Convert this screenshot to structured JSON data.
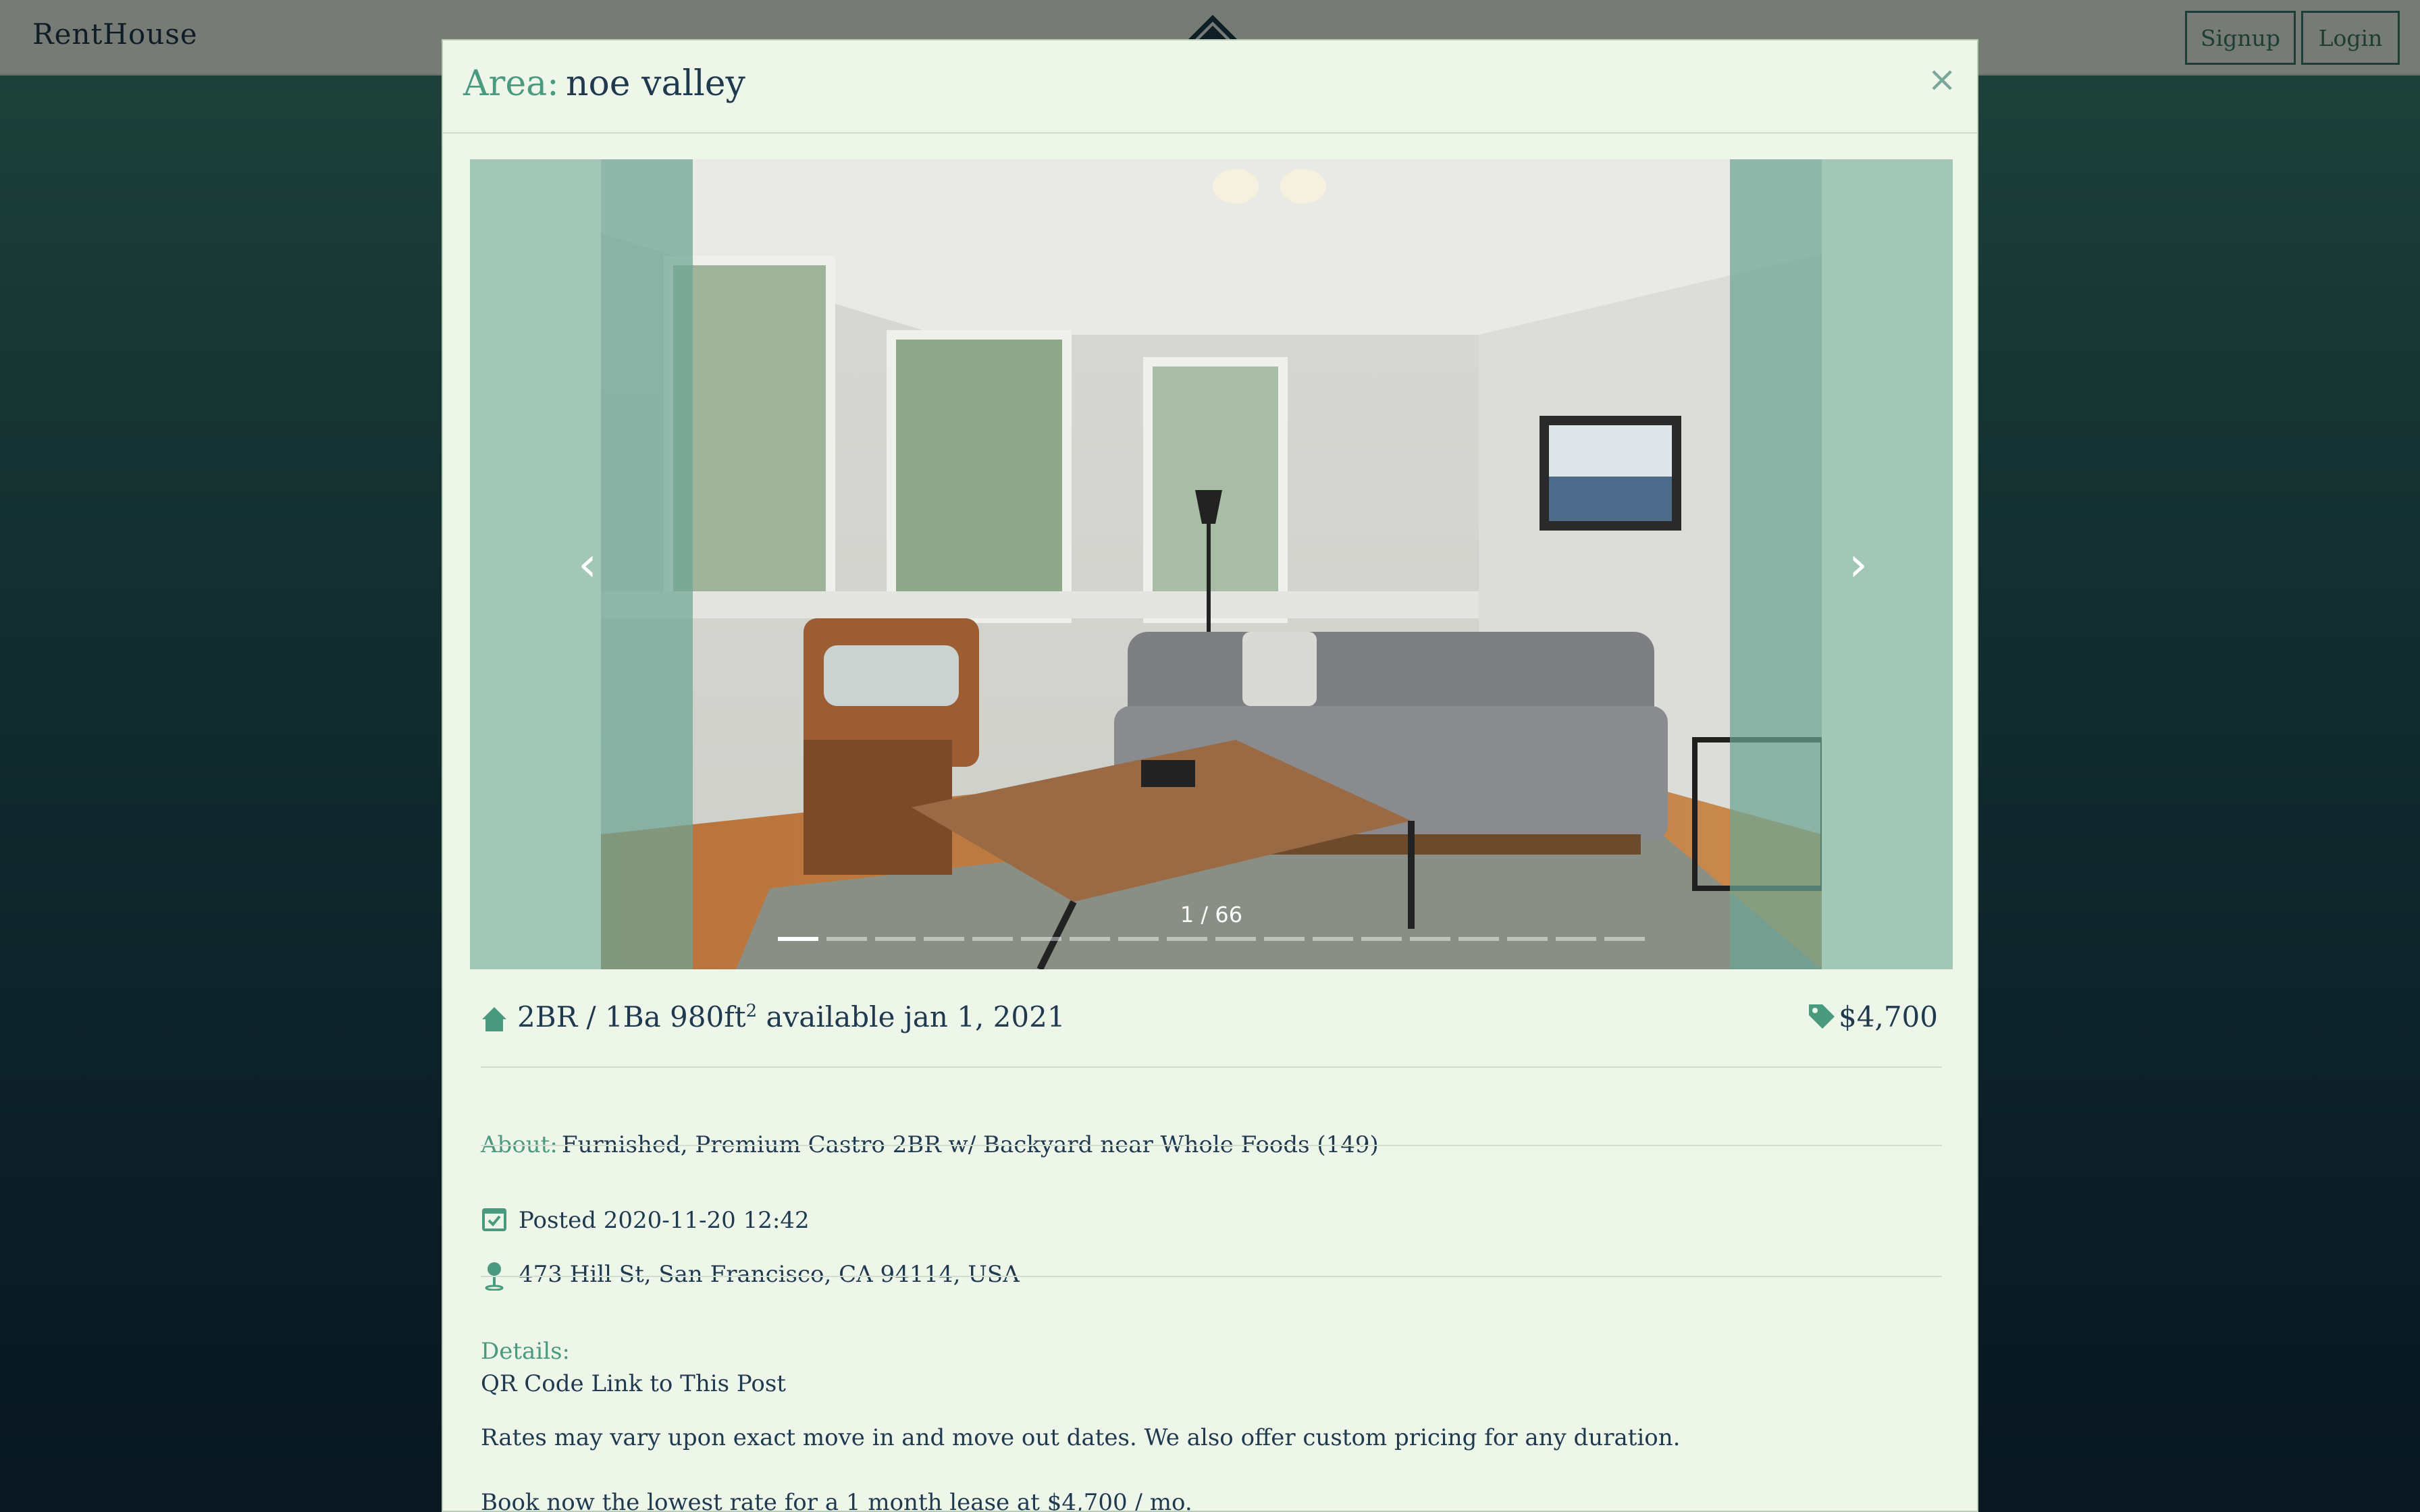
{
  "navbar": {
    "brand": "RentHouse",
    "signup_label": "Signup",
    "login_label": "Login"
  },
  "modal": {
    "area_label": "Area:",
    "area_value": "noe valley",
    "close_label": "×"
  },
  "carousel": {
    "counter": "1 / 66",
    "prev_label": "‹",
    "next_label": "›",
    "dot_count_visible": 18,
    "active_dot": 0
  },
  "listing": {
    "beds_baths": "2BR / 1Ba 980ft",
    "area_sup": "2",
    "available": "available jan 1, 2021",
    "price": "$4,700",
    "about_label": "About:",
    "about_text": "Furnished, Premium Castro 2BR w/ Backyard near Whole Foods (149)",
    "posted": "Posted 2020-11-20 12:42",
    "address": "473 Hill St, San Francisco, CA 94114, USA",
    "details_label": "Details:",
    "qr_link": "QR Code Link to This Post",
    "details_p1": "Rates may vary upon exact move in and move out dates. We also offer custom pricing for any duration.",
    "details_p2": "Book now the lowest rate for a 1 month lease at $4,700 / mo."
  },
  "colors": {
    "accent": "#4a9a80",
    "text": "#1f3a4f",
    "modal_bg": "#eef6ea",
    "carousel_bg": "#a2c7b6"
  },
  "icons": {
    "house": "house-icon",
    "tag": "price-tag-icon",
    "calendar": "calendar-check-icon",
    "pin": "map-pin-icon",
    "logo": "house-logo-icon"
  }
}
